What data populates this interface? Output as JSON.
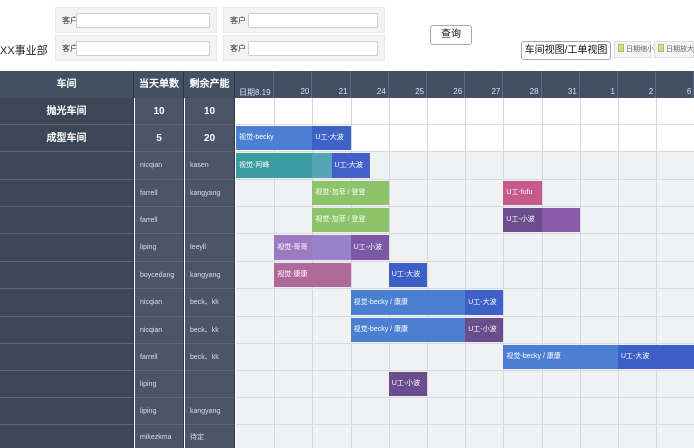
{
  "filters": {
    "dept_label": "XX事业部",
    "customer_label": "客户",
    "query_button": "查询",
    "view_toggle": "车间视图/工单视图",
    "zoom_out": "日期缩小",
    "zoom_in": "日期放大"
  },
  "header": {
    "col_workshop": "车间",
    "col_daily": "当天单数",
    "col_capacity": "剩余产能",
    "dates": [
      "日期8.19",
      "20",
      "21",
      "24",
      "25",
      "26",
      "27",
      "28",
      "31",
      "1",
      "2",
      "6"
    ]
  },
  "rows": [
    {
      "ws": "抛光车间",
      "a": "10",
      "b": "10"
    },
    {
      "ws": "成型车间",
      "a": "5",
      "b": "20"
    },
    {
      "ws": "",
      "a": "nicqian",
      "b": "kasen"
    },
    {
      "ws": "",
      "a": "farrell",
      "b": "kangyang"
    },
    {
      "ws": "",
      "a": "farrell",
      "b": ""
    },
    {
      "ws": "",
      "a": "liping",
      "b": "leeyll"
    },
    {
      "ws": "",
      "a": "boycedang",
      "b": "kangyang"
    },
    {
      "ws": "",
      "a": "nicqian",
      "b": "beck、kk"
    },
    {
      "ws": "",
      "a": "nicqian",
      "b": "beck、kk"
    },
    {
      "ws": "",
      "a": "farrell",
      "b": "beck、kk"
    },
    {
      "ws": "",
      "a": "liping",
      "b": ""
    },
    {
      "ws": "",
      "a": "liping",
      "b": "kangyang"
    },
    {
      "ws": "",
      "a": "mikezkma",
      "b": "待定"
    }
  ],
  "bars": [
    {
      "row": 1,
      "start": 0,
      "span": 2,
      "label": "视觉-becky",
      "color": "#4a7fd2"
    },
    {
      "row": 1,
      "start": 2,
      "span": 1,
      "label": "U工-大波",
      "color": "#3d63c7"
    },
    {
      "row": 2,
      "start": 0,
      "span": 2,
      "label": "视觉-阿峰",
      "color": "#3a9ba0"
    },
    {
      "row": 2,
      "start": 2,
      "span": 1,
      "label": "",
      "color": "#52a6b6"
    },
    {
      "row": 2,
      "start": 2.5,
      "span": 1,
      "label": "U工-大波",
      "color": "#4460c8"
    },
    {
      "row": 3,
      "start": 2,
      "span": 2,
      "label": "视觉-加菲 / 登登",
      "color": "#8dc36a"
    },
    {
      "row": 3,
      "start": 7,
      "span": 1,
      "label": "U工-fufu",
      "color": "#c65a8c"
    },
    {
      "row": 4,
      "start": 2,
      "span": 2,
      "label": "视觉-加菲 / 登登",
      "color": "#8dc36a"
    },
    {
      "row": 4,
      "start": 7,
      "span": 1,
      "label": "U工-小波",
      "color": "#6a4d8c"
    },
    {
      "row": 4,
      "start": 8,
      "span": 1,
      "label": "",
      "color": "#8a5aa8"
    },
    {
      "row": 5,
      "start": 1,
      "span": 1,
      "label": "视觉-哥哥",
      "color": "#9a7ac0"
    },
    {
      "row": 5,
      "start": 2,
      "span": 1,
      "label": "",
      "color": "#9882c8"
    },
    {
      "row": 5,
      "start": 3,
      "span": 1,
      "label": "U工-小波",
      "color": "#7a5aa6"
    },
    {
      "row": 6,
      "start": 1,
      "span": 2,
      "label": "视觉-康康",
      "color": "#b06a9a"
    },
    {
      "row": 6,
      "start": 4,
      "span": 1,
      "label": "U工-大波",
      "color": "#3d5fc6"
    },
    {
      "row": 7,
      "start": 3,
      "span": 3,
      "label": "视觉-becky / 康康",
      "color": "#4a7fd2"
    },
    {
      "row": 7,
      "start": 6,
      "span": 1,
      "label": "U工-大波",
      "color": "#3d5fc6"
    },
    {
      "row": 8,
      "start": 3,
      "span": 3,
      "label": "视觉-becky / 康康",
      "color": "#4a7fd2"
    },
    {
      "row": 8,
      "start": 6,
      "span": 1,
      "label": "U工-小波",
      "color": "#6a4d8c"
    },
    {
      "row": 9,
      "start": 7,
      "span": 3,
      "label": "视觉-becky / 康康",
      "color": "#4a7fd2"
    },
    {
      "row": 9,
      "start": 10,
      "span": 2,
      "label": "U工-大波",
      "color": "#3d5fc6"
    },
    {
      "row": 10,
      "start": 4,
      "span": 1,
      "label": "U工-小波",
      "color": "#6a4d8c"
    }
  ]
}
